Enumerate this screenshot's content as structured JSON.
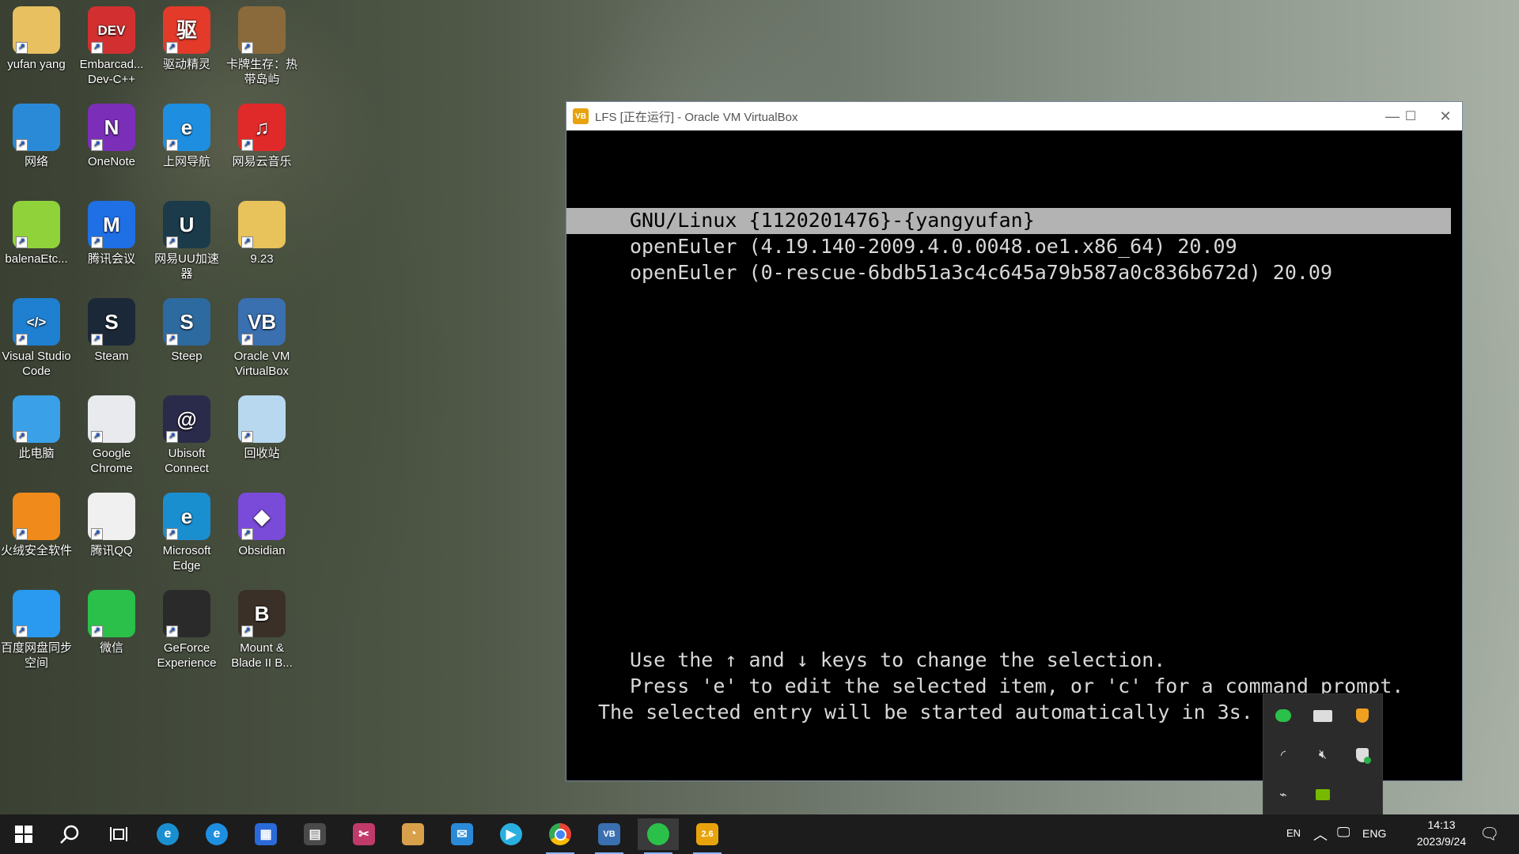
{
  "desktop": {
    "icons": [
      {
        "label": "yufan yang",
        "icon": "user-folder-icon",
        "color": "#e8c060",
        "glyph": ""
      },
      {
        "label": "Embarcad... Dev-C++",
        "icon": "devcpp-icon",
        "color": "#d23030",
        "glyph": "DEV"
      },
      {
        "label": "驱动精灵",
        "icon": "driver-genius-icon",
        "color": "#e33a2a",
        "glyph": "驱"
      },
      {
        "label": "卡牌生存：热带岛屿",
        "icon": "coconut-game-icon",
        "color": "#8a6a3a",
        "glyph": ""
      },
      {
        "label": "网络",
        "icon": "network-icon",
        "color": "#2a8ad8",
        "glyph": ""
      },
      {
        "label": "OneNote",
        "icon": "onenote-icon",
        "color": "#7b2fb8",
        "glyph": "N"
      },
      {
        "label": "上网导航",
        "icon": "ie-navigation-icon",
        "color": "#1e8fe0",
        "glyph": "e"
      },
      {
        "label": "网易云音乐",
        "icon": "netease-music-icon",
        "color": "#e02a2a",
        "glyph": "♫"
      },
      {
        "label": "balenaEtc...",
        "icon": "balena-etcher-icon",
        "color": "#8fd23a",
        "glyph": ""
      },
      {
        "label": "腾讯会议",
        "icon": "tencent-meeting-icon",
        "color": "#1f6fe5",
        "glyph": "M"
      },
      {
        "label": "网易UU加速器",
        "icon": "uu-booster-icon",
        "color": "#1b3a4a",
        "glyph": "U"
      },
      {
        "label": "9.23",
        "icon": "folder-icon",
        "color": "#e8c25a",
        "glyph": ""
      },
      {
        "label": "Visual Studio Code",
        "icon": "vscode-icon",
        "color": "#1f7fd0",
        "glyph": "&lt;/&gt;"
      },
      {
        "label": "Steam",
        "icon": "steam-icon",
        "color": "#1b2838",
        "glyph": "S"
      },
      {
        "label": "Steep",
        "icon": "steep-icon",
        "color": "#2d6aa0",
        "glyph": "S"
      },
      {
        "label": "Oracle VM VirtualBox",
        "icon": "virtualbox-icon",
        "color": "#3a6fb0",
        "glyph": "VB"
      },
      {
        "label": "此电脑",
        "icon": "this-pc-icon",
        "color": "#3aa0e8",
        "glyph": ""
      },
      {
        "label": "Google Chrome",
        "icon": "chrome-icon",
        "color": "#e8eaed",
        "glyph": ""
      },
      {
        "label": "Ubisoft Connect",
        "icon": "ubisoft-icon",
        "color": "#2a2a4a",
        "glyph": "@"
      },
      {
        "label": "回收站",
        "icon": "recycle-bin-icon",
        "color": "#b8d8f0",
        "glyph": ""
      },
      {
        "label": "火绒安全软件",
        "icon": "huorong-icon",
        "color": "#f08a1a",
        "glyph": ""
      },
      {
        "label": "腾讯QQ",
        "icon": "qq-icon",
        "color": "#f0f0f0",
        "glyph": ""
      },
      {
        "label": "Microsoft Edge",
        "icon": "edge-icon",
        "color": "#1a8fd0",
        "glyph": "e"
      },
      {
        "label": "Obsidian",
        "icon": "obsidian-icon",
        "color": "#7a4ad8",
        "glyph": "◆"
      },
      {
        "label": "百度网盘同步空间",
        "icon": "baidu-sync-icon",
        "color": "#2a9af0",
        "glyph": ""
      },
      {
        "label": "微信",
        "icon": "wechat-icon",
        "color": "#2ac04a",
        "glyph": ""
      },
      {
        "label": "GeForce Experience",
        "icon": "geforce-icon",
        "color": "#2a2a2a",
        "glyph": ""
      },
      {
        "label": "Mount & Blade II B...",
        "icon": "bannerlord-icon",
        "color": "#3a3028",
        "glyph": "B"
      }
    ]
  },
  "vbox_window": {
    "title": "LFS [正在运行] - Oracle VM VirtualBox",
    "minimize": "—",
    "maximize": "☐",
    "close": "✕",
    "grub": {
      "entries": [
        "GNU/Linux {1120201476}-{yangyufan}",
        "openEuler (4.19.140-2009.4.0.0048.oe1.x86_64) 20.09",
        "openEuler (0-rescue-6bdb51a3c4c645a79b587a0c836b672d) 20.09"
      ],
      "selected_index": 0,
      "help_line1": "Use the ↑ and ↓ keys to change the selection.",
      "help_line2": "Press 'e' to edit the selected item, or 'c' for a command prompt.",
      "help_line3": "The selected entry will be started automatically in 3s."
    }
  },
  "tray_overflow": {
    "icons": [
      "wechat-tray-icon",
      "battery-tray-icon",
      "huorong-tray-icon",
      "network-tray-icon",
      "volume-muted-tray-icon",
      "defender-tray-icon",
      "satellite-tray-icon",
      "nvidia-tray-icon"
    ]
  },
  "taskbar": {
    "apps": [
      {
        "name": "edge",
        "icon": "edge-icon",
        "color": "#1a8fd0",
        "glyph": "e"
      },
      {
        "name": "ie",
        "icon": "ie-icon",
        "color": "#1e8fe0",
        "glyph": "e"
      },
      {
        "name": "calendar",
        "icon": "calendar-icon",
        "color": "#2a6ad8",
        "glyph": "▦"
      },
      {
        "name": "calculator",
        "icon": "calculator-icon",
        "color": "#4a4a4a",
        "glyph": "▤"
      },
      {
        "name": "snip",
        "icon": "scissors-icon",
        "color": "#c03a6a",
        "glyph": "✂"
      },
      {
        "name": "paint",
        "icon": "paint-icon",
        "color": "#d8a04a",
        "glyph": "◔"
      },
      {
        "name": "mail",
        "icon": "mail-icon",
        "color": "#2a8ad8",
        "glyph": "✉"
      },
      {
        "name": "media",
        "icon": "media-player-icon",
        "color": "#2ab0e0",
        "glyph": "▶"
      },
      {
        "name": "chrome",
        "icon": "chrome-icon",
        "color": "#e8eaed",
        "glyph": ""
      },
      {
        "name": "virtualbox",
        "icon": "virtualbox-icon",
        "color": "#3a6fb0",
        "glyph": "VB"
      },
      {
        "name": "wechat",
        "icon": "wechat-icon",
        "color": "#2ac04a",
        "glyph": ""
      },
      {
        "name": "lfs-vm",
        "icon": "vm-running-icon",
        "color": "#e8a30c",
        "glyph": "2.6"
      }
    ],
    "lang_short": "EN",
    "lang": "ENG",
    "time": "14:13",
    "date": "2023/9/24"
  }
}
